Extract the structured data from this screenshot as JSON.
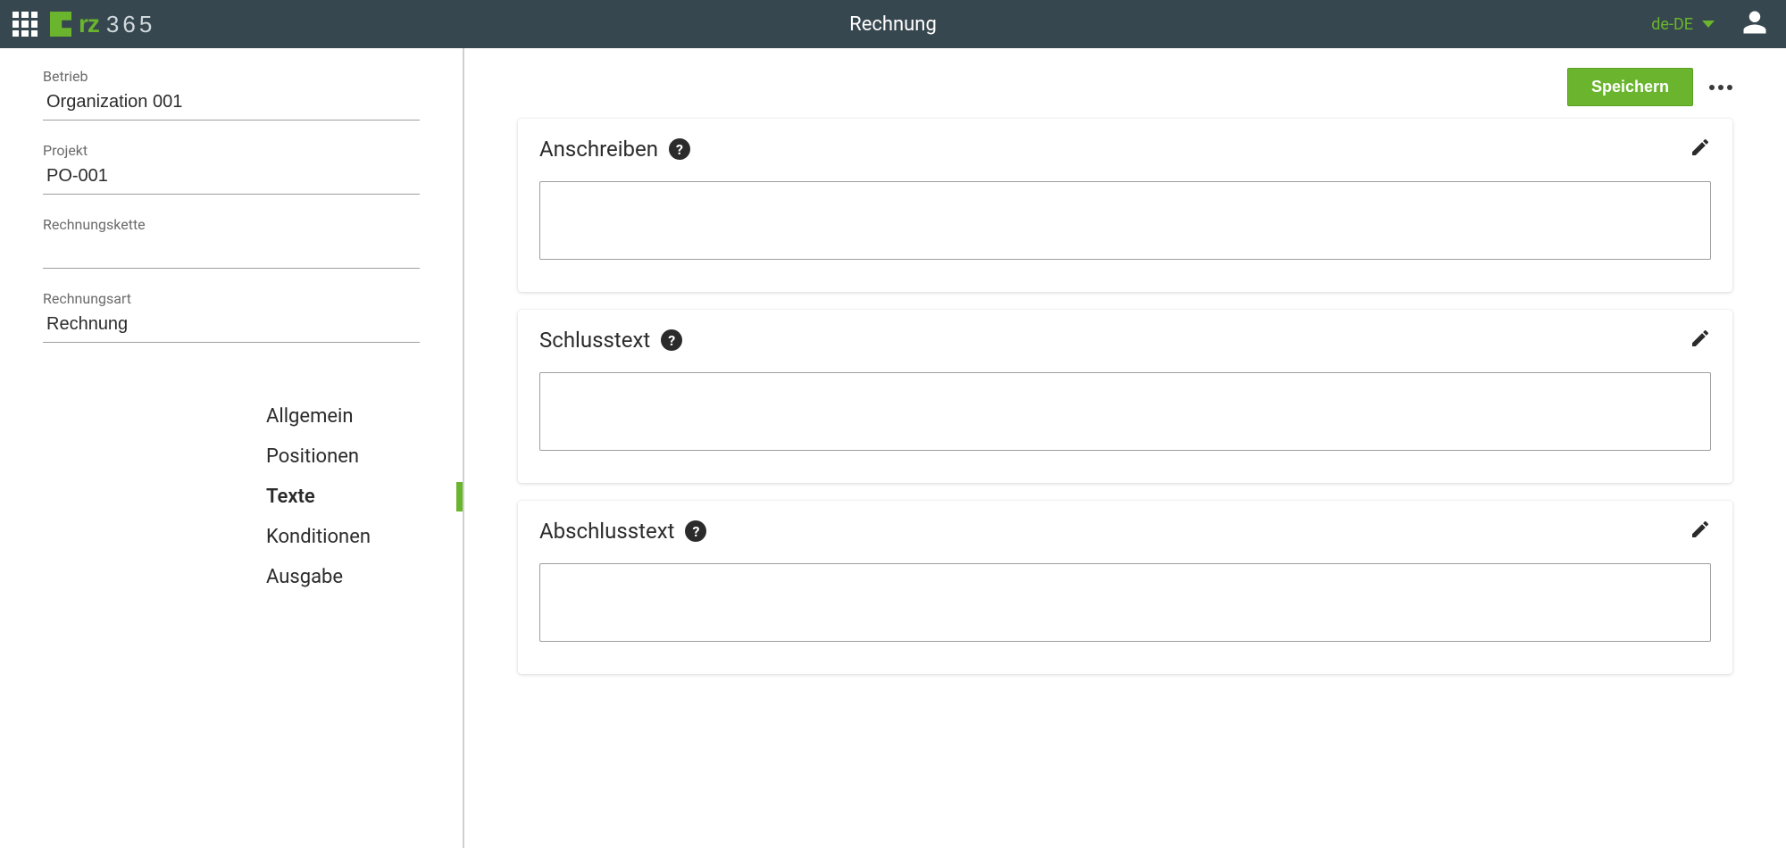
{
  "appbar": {
    "title": "Rechnung",
    "language": "de-DE"
  },
  "actions": {
    "save_label": "Speichern"
  },
  "sidebar": {
    "fields": {
      "betrieb_label": "Betrieb",
      "betrieb_value": "Organization 001",
      "projekt_label": "Projekt",
      "projekt_value": "PO-001",
      "rechnungskette_label": "Rechnungskette",
      "rechnungskette_value": "",
      "rechnungsart_label": "Rechnungsart",
      "rechnungsart_value": "Rechnung"
    },
    "nav": {
      "allgemein": "Allgemein",
      "positionen": "Positionen",
      "texte": "Texte",
      "konditionen": "Konditionen",
      "ausgabe": "Ausgabe",
      "active": "texte"
    }
  },
  "cards": {
    "anschreiben": {
      "title": "Anschreiben",
      "body": ""
    },
    "schlusstext": {
      "title": "Schlusstext",
      "body": ""
    },
    "abschlusstext": {
      "title": "Abschlusstext",
      "body": ""
    }
  }
}
